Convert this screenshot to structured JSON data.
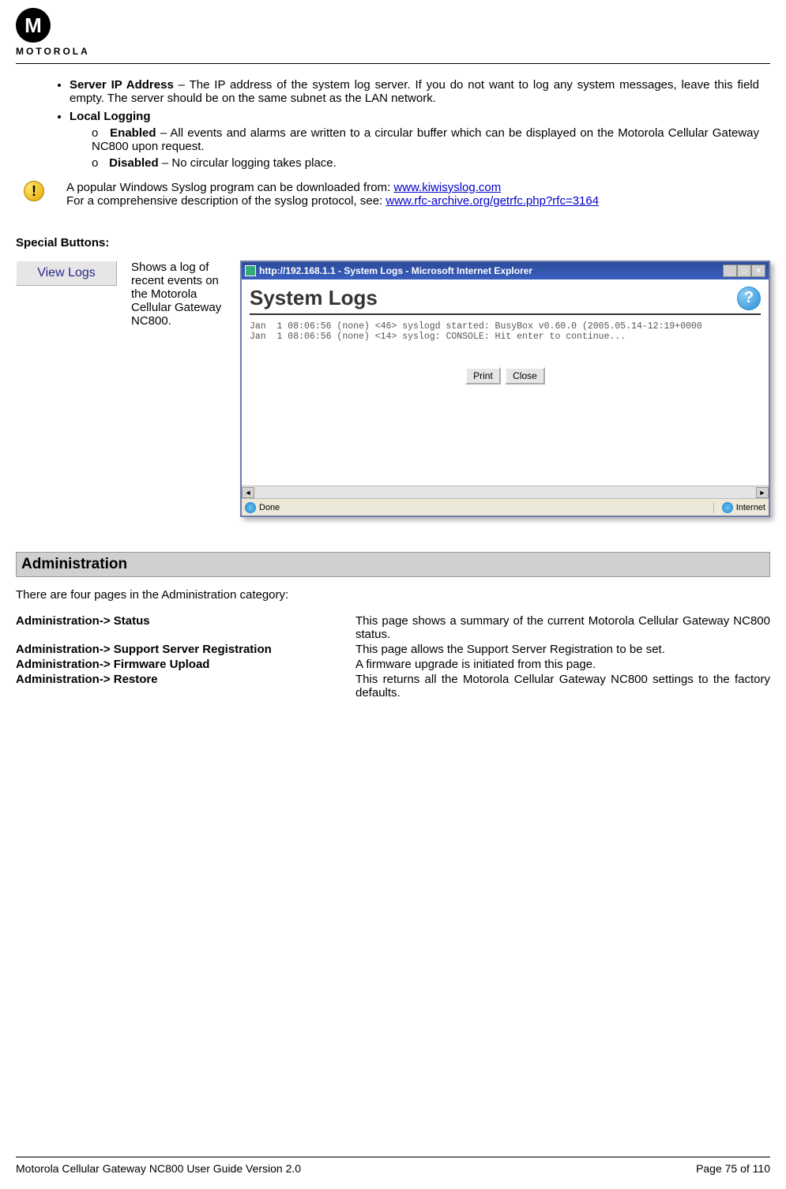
{
  "header": {
    "logo_glyph": "M",
    "logo_text": "MOTOROLA"
  },
  "bullets": {
    "server_ip_label": "Server IP Address",
    "server_ip_text": " – The IP address of the system log server. If you do not want to log any system messages, leave this field empty. The server should be on the same subnet as the LAN network.",
    "local_logging_label": "Local Logging",
    "enabled_label": "Enabled",
    "enabled_text": " – All events and alarms are written to a circular buffer which can be displayed on the Motorola Cellular Gateway NC800 upon request.",
    "disabled_label": "Disabled",
    "disabled_text": " – No circular logging takes place."
  },
  "tip": {
    "line1": "A popular Windows Syslog program can be downloaded from: ",
    "link1": "www.kiwisyslog.com",
    "line2": "For a comprehensive description of the syslog protocol, see:  ",
    "link2": "www.rfc-archive.org/getrfc.php?rfc=3164"
  },
  "special": {
    "title": "Special Buttons:",
    "view_logs_btn": "View Logs",
    "view_logs_desc": "Shows a log of recent events on the Motorola Cellular Gateway NC800."
  },
  "browser": {
    "title": "http://192.168.1.1 - System Logs - Microsoft Internet Explorer",
    "min": "_",
    "max": "□",
    "close": "×",
    "sys_logs_title": "System Logs",
    "help_glyph": "?",
    "log_line1": "Jan  1 08:06:56 (none) <46> syslogd started: BusyBox v0.60.0 (2005.05.14-12:19+0000",
    "log_line2": "Jan  1 08:06:56 (none) <14> syslog: CONSOLE: Hit enter to continue...",
    "print_btn": "Print",
    "close_btn": "Close",
    "left_arrow": "◄",
    "right_arrow": "►",
    "status_done": "Done",
    "status_zone": "Internet"
  },
  "admin": {
    "section_title": "Administration",
    "intro": "There are four pages in the Administration category:",
    "rows": [
      {
        "label": "Administration-> Status",
        "desc": "This page shows a summary of the current Motorola Cellular Gateway NC800 status."
      },
      {
        "label": "Administration-> Support Server Registration",
        "desc": "This page allows the Support Server Registration to be set."
      },
      {
        "label": "Administration-> Firmware Upload",
        "desc": "A firmware upgrade is initiated from this page."
      },
      {
        "label": "Administration-> Restore",
        "desc": "This returns all the Motorola Cellular Gateway NC800 settings to the factory defaults."
      }
    ]
  },
  "footer": {
    "left": "Motorola Cellular Gateway NC800 User Guide Version 2.0",
    "right": "Page 75 of 110"
  }
}
